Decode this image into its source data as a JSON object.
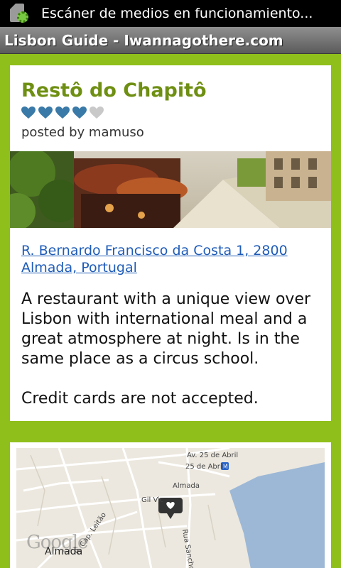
{
  "status_bar": {
    "icon": "media-scanner-gear-icon",
    "text": "Escáner de medios en funcionamiento..."
  },
  "title_bar": {
    "title": "Lisbon Guide - Iwannagothere.com"
  },
  "place": {
    "name": "Restô do Chapitô",
    "rating": {
      "value": 4,
      "max": 5,
      "icon": "heart-icon",
      "filled_color": "#3a7aa8",
      "empty_color": "#c9c9c9"
    },
    "posted_prefix": "posted by ",
    "author": "mamuso",
    "address": "R. Bernardo Francisco da Costa 1, 2800 Almada, Portugal",
    "description": "A restaurant with a unique view over Lisbon with international meal and a great atmosphere at night. Is in the same place as a circus school.",
    "note": "Credit cards are not accepted."
  },
  "map": {
    "labels": {
      "street_1": "Av. 25 de Abril",
      "street_2": "25 de Abril",
      "metro": "M",
      "poi_1": "Almada",
      "poi_2": "Gil Vic",
      "street_3": "R. Cap. Leitão",
      "street_4": "Rua Sancho",
      "city": "Almada",
      "logo": "Google"
    },
    "colors": {
      "water": "#9db8d6",
      "land": "#ece8df",
      "road": "#ffffff"
    }
  },
  "colors": {
    "background": "#8fbf1a",
    "title_green": "#6e8f12",
    "link_blue": "#1f5cb8"
  }
}
